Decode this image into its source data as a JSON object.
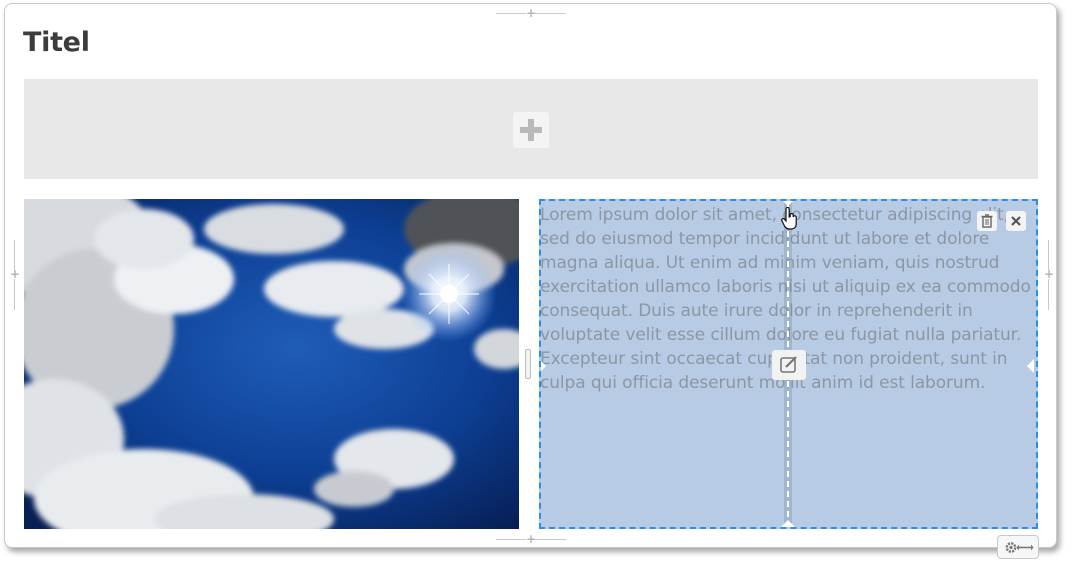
{
  "page": {
    "title": "Titel"
  },
  "text_block": {
    "content": "Lorem ipsum dolor sit amet, consectetur adipiscing elit, sed do eiusmod tempor incididunt ut labore et dolore magna aliqua. Ut enim ad minim veniam, quis nostrud exercitation ullamco laboris nisi ut aliquip ex ea commodo consequat. Duis aute irure dolor in reprehenderit in voluptate velit esse cillum dolore eu fugiat nulla pariatur. Excepteur sint occaecat cupidatat non proident, sunt in culpa qui officia deserunt mollit anim id est laborum."
  },
  "icons": {
    "add": "plus-icon",
    "delete": "trash-icon",
    "close": "close-icon",
    "edit": "edit-icon",
    "settings": "gear-icon",
    "width": "horizontal-arrows-icon",
    "cursor": "hand-pointer-icon"
  },
  "colors": {
    "selection_fill": "#b8cbe4",
    "selection_border": "#2b8ee8",
    "placeholder_bg": "#e8e8e8"
  }
}
